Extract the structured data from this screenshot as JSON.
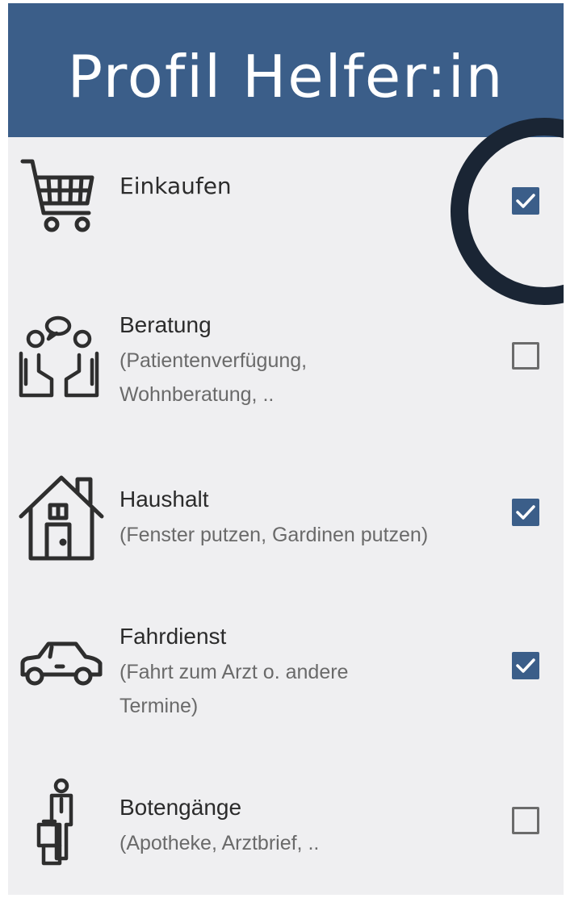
{
  "header": {
    "title": "Profil Helfer:in"
  },
  "colors": {
    "header_bg": "#3b5e89",
    "checkbox_checked": "#3b5e89",
    "ring": "#1a2534"
  },
  "services": [
    {
      "label": "Einkaufen",
      "description": "",
      "checked": true,
      "icon": "shopping-cart-icon"
    },
    {
      "label": "Beratung",
      "description": "(Patientenverfügung, Wohnberatung, ..",
      "checked": false,
      "icon": "consultation-icon"
    },
    {
      "label": "Haushalt",
      "description": "(Fenster putzen, Gardinen putzen)",
      "checked": true,
      "icon": "house-icon"
    },
    {
      "label": "Fahrdienst",
      "description": "(Fahrt zum Arzt o. andere Termine)",
      "checked": true,
      "icon": "car-icon"
    },
    {
      "label": "Botengänge",
      "description": "(Apotheke, Arztbrief, ..",
      "checked": false,
      "icon": "courier-icon"
    }
  ]
}
